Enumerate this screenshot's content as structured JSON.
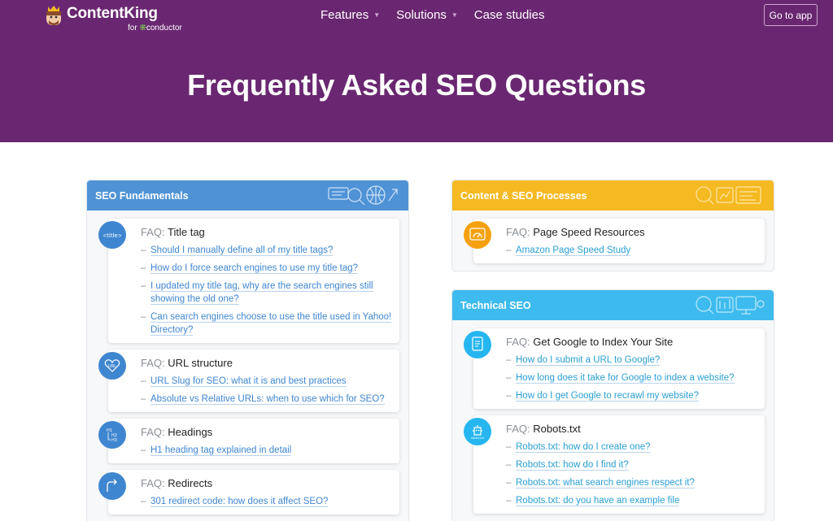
{
  "header": {
    "logo_name": "ContentKing",
    "logo_sub_prefix": "for",
    "logo_sub_brand": "conductor",
    "nav": [
      {
        "label": "Features",
        "has_caret": true
      },
      {
        "label": "Solutions",
        "has_caret": true
      },
      {
        "label": "Case studies",
        "has_caret": false
      }
    ],
    "cta_label": "Go to app",
    "title": "Frequently Asked SEO Questions",
    "bg_color": "#6a2771"
  },
  "faq_prefix": "FAQ:",
  "sections": {
    "seo_fundamentals": {
      "title": "SEO Fundamentals",
      "color": "#4f93d6",
      "cards": [
        {
          "title": "Title tag",
          "icon": "title-tag-icon",
          "links": [
            "Should I manually define all of my title tags?",
            "How do I force search engines to use my title tag?",
            "I updated my title tag, why are the search engines still showing the old one?",
            "Can search engines choose to use the title used in Yahoo! Directory?"
          ]
        },
        {
          "title": "URL structure",
          "icon": "url-structure-icon",
          "links": [
            "URL Slug for SEO: what it is and best practices",
            "Absolute vs Relative URLs: when to use which for SEO?"
          ]
        },
        {
          "title": "Headings",
          "icon": "headings-icon",
          "links": [
            "H1 heading tag explained in detail"
          ]
        },
        {
          "title": "Redirects",
          "icon": "redirects-icon",
          "links": [
            "301 redirect code: how does it affect SEO?"
          ]
        }
      ]
    },
    "content_processes": {
      "title": "Content & SEO Processes",
      "color": "#f5b922",
      "cards": [
        {
          "title": "Page Speed Resources",
          "icon": "page-speed-icon",
          "links": [
            "Amazon Page Speed Study"
          ]
        }
      ]
    },
    "technical_seo": {
      "title": "Technical SEO",
      "color": "#3dbbee",
      "cards": [
        {
          "title": "Get Google to Index Your Site",
          "icon": "index-icon",
          "links": [
            "How do I submit a URL to Google?",
            "How long does it take for Google to index a website?",
            "How do I get Google to recrawl my website?"
          ]
        },
        {
          "title": "Robots.txt",
          "icon": "robots-txt-icon",
          "links": [
            "Robots.txt: how do I create one?",
            "Robots.txt: how do I find it?",
            "Robots.txt: what search engines respect it?",
            "Robots.txt: do you have an example file"
          ]
        }
      ]
    }
  }
}
